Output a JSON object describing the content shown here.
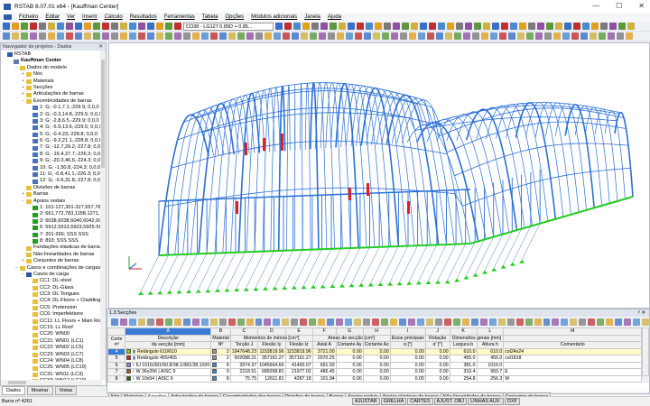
{
  "window": {
    "title": "RSTAB 8.07.01 x64 - [Kauffman Center]",
    "min": "—",
    "max": "☐",
    "close": "✕"
  },
  "menu": [
    "Ficheiro",
    "Editar",
    "Ver",
    "Inserir",
    "Cálculo",
    "Resultados",
    "Ferramentas",
    "Tabela",
    "Opções",
    "Módulos adicionais",
    "Janela",
    "Ajuda"
  ],
  "toolbar": {
    "load_combo": "CO38 - LG127 0.85D + 0.85..."
  },
  "navigator": {
    "title": "Navegador de projetos - Dados",
    "close": "✕",
    "pin": "ᵖ",
    "items": [
      {
        "d": 0,
        "t": "RSTAB",
        "i": "app"
      },
      {
        "d": 1,
        "t": "Kauffman Center",
        "i": "model",
        "b": true
      },
      {
        "d": 2,
        "t": "Dados do modelo",
        "i": "folder",
        "e": "−"
      },
      {
        "d": 3,
        "t": "Nós",
        "i": "folder",
        "e": "+"
      },
      {
        "d": 3,
        "t": "Materiais",
        "i": "folder",
        "e": "+"
      },
      {
        "d": 3,
        "t": "Secções",
        "i": "folder",
        "e": "+"
      },
      {
        "d": 3,
        "t": "Articulações de barras",
        "i": "folder",
        "e": "+"
      },
      {
        "d": 3,
        "t": "Excentricidades de barras",
        "i": "folder",
        "e": "−"
      },
      {
        "d": 4,
        "t": "1: G; -0.1,7.1,-229.9; 0,0,0",
        "i": "ecc"
      },
      {
        "d": 4,
        "t": "2: G; -0.3,14.8,-229.5; 0,0,0",
        "i": "ecc"
      },
      {
        "d": 4,
        "t": "3: G; -2.8,6.5,-229.9; 0,0,0",
        "i": "ecc"
      },
      {
        "d": 4,
        "t": "4: G; -5.9,13.6,-229.5; 0,0,0",
        "i": "ecc"
      },
      {
        "d": 4,
        "t": "5: G; -0.4,23,-228.8; 0,0,0",
        "i": "ecc"
      },
      {
        "d": 4,
        "t": "6: G; -9.2,21.1,-228.8; 0,0,0",
        "i": "ecc"
      },
      {
        "d": 4,
        "t": "7: G; -12.7,29.2,-227.8; 0,0,0",
        "i": "ecc"
      },
      {
        "d": 4,
        "t": "8: G; -16.4,37.7,-226.3; 0,0,0",
        "i": "ecc"
      },
      {
        "d": 4,
        "t": "9: G; -20.3,46.6,-224.3; 0,0,0",
        "i": "ecc"
      },
      {
        "d": 4,
        "t": "10: G; -1,50.8,-224.3; 0,0,0",
        "i": "ecc"
      },
      {
        "d": 4,
        "t": "11: G; -0.8,41.1,-226.3; 0,0,0",
        "i": "ecc"
      },
      {
        "d": 4,
        "t": "12: G; -0.6,31.8,-227.8; 0,0,0",
        "i": "ecc"
      },
      {
        "d": 3,
        "t": "Divisões de barras",
        "i": "folder"
      },
      {
        "d": 3,
        "t": "Barras",
        "i": "folder",
        "e": "+"
      },
      {
        "d": 3,
        "t": "Apoios nodais",
        "i": "folder",
        "e": "−"
      },
      {
        "d": 4,
        "t": "1: 101-127,301-327,657,768,779",
        "i": "sup"
      },
      {
        "d": 4,
        "t": "2: 661,772,783,1158,1271,1276,1",
        "i": "sup"
      },
      {
        "d": 4,
        "t": "3: 6038,6038,6040,6042,6044,60",
        "i": "sup"
      },
      {
        "d": 4,
        "t": "6: 5912,5913,5923,5925-5928,61",
        "i": "sup"
      },
      {
        "d": 4,
        "t": "7: 201-266; SSS SSS",
        "i": "sup"
      },
      {
        "d": 4,
        "t": "8: 893; SSS SSS",
        "i": "sup"
      },
      {
        "d": 3,
        "t": "Fundações elásticas de barras",
        "i": "folder"
      },
      {
        "d": 3,
        "t": "Não-linearidades de barras",
        "i": "folder"
      },
      {
        "d": 3,
        "t": "Conjuntos de barras",
        "i": "folder",
        "e": "+"
      },
      {
        "d": 2,
        "t": "Casos e combinações de cargass",
        "i": "folder",
        "e": "−"
      },
      {
        "d": 3,
        "t": "Casos de carga",
        "i": "lc",
        "e": "−"
      },
      {
        "d": 4,
        "t": "CC1: DL-steel",
        "i": "folder"
      },
      {
        "d": 4,
        "t": "CC2: DL-Glass",
        "i": "folder"
      },
      {
        "d": 4,
        "t": "CC3: DL Tongues",
        "i": "folder"
      },
      {
        "d": 4,
        "t": "CC4: DL-Floors + Cladding",
        "i": "folder"
      },
      {
        "d": 4,
        "t": "CC5: Pretension",
        "i": "folder"
      },
      {
        "d": 4,
        "t": "CC6: Imperfektions",
        "i": "folder"
      },
      {
        "d": 4,
        "t": "CC11: LL Floors + Main Roof",
        "i": "folder"
      },
      {
        "d": 4,
        "t": "CC15: LL Roof",
        "i": "folder"
      },
      {
        "d": 4,
        "t": "CC20: WN00",
        "i": "folder"
      },
      {
        "d": 4,
        "t": "CC21: WN01 (LC1)",
        "i": "folder"
      },
      {
        "d": 4,
        "t": "CC22: WN02 (LC5)",
        "i": "folder"
      },
      {
        "d": 4,
        "t": "CC23: WN03 (LC7)",
        "i": "folder"
      },
      {
        "d": 4,
        "t": "CC24: WN04 (LC8)",
        "i": "folder"
      },
      {
        "d": 4,
        "t": "CC25: WN05 (LC19)",
        "i": "folder"
      },
      {
        "d": 4,
        "t": "CC31: WN11 (LC3)",
        "i": "folder"
      },
      {
        "d": 4,
        "t": "CC32: WN12 (LC10)",
        "i": "folder"
      }
    ],
    "tabs": [
      "Dados",
      "Mostrar",
      "Vistas"
    ]
  },
  "panel": {
    "title": "1.3 Secções",
    "close": "ᵖ ✕",
    "letters": [
      "A",
      "B",
      "C",
      "D",
      "E",
      "F",
      "G",
      "H",
      "I",
      "J",
      "K",
      "L",
      "M"
    ],
    "groups": {
      "corte": "Corte nº",
      "desc": "Descrição",
      "material": "Material",
      "moments": "Momentos de inércia [cm⁴]",
      "areas": "Áreas de secção [cm²]",
      "axes": "Eixos principais",
      "rot": "Rotação",
      "dims": "Dimensões gerais [mm]"
    },
    "sub": [
      "da secção [mm]",
      "Nº",
      "Torção J",
      "Flexão Iy",
      "Flexão Iz",
      "Axial A",
      "Cortante Ay",
      "Cortante Az",
      "α [°]",
      "α' [°]",
      "Largura b",
      "Altura h",
      "Comentário"
    ],
    "rows": [
      {
        "no": "4",
        "color": "#8fbf2f",
        "shape": "▮",
        "desc": "Retângulo 610/610",
        "mc": "#9a9a9a",
        "mat": "2",
        "J": "1947648.23",
        "Iy": "1153819.96",
        "Iz": "1153819.96",
        "A": "3721.00",
        "Ay": "0.00",
        "Az": "0.00",
        "a": "0.00",
        "a2": "0.00",
        "b": "610.0",
        "h": "610.0",
        "c": "col24x24"
      },
      {
        "no": "5",
        "color": "#e01818",
        "shape": "▮",
        "desc": "Retângulo 455/455",
        "mc": "#9a9a9a",
        "mat": "2",
        "J": "602088.21",
        "Iy": "357161.27",
        "Iz": "357161.27",
        "A": "2070.25",
        "Ay": "0.00",
        "Az": "0.00",
        "a": "0.00",
        "a2": "0.00",
        "b": "455.0",
        "h": "455.0",
        "c": "col1818"
      },
      {
        "no": "6",
        "color": "#9a8ae0",
        "shape": "I",
        "desc": "IU 1016/381/50.8/38.1/381/38.1/0/0",
        "mc": "#3a8ee8",
        "mat": "8",
        "J": "3974.37",
        "Iy": "1045664.66",
        "Iz": "41400.07",
        "A": "691.93",
        "Ay": "0.00",
        "Az": "0.00",
        "a": "0.00",
        "a2": "0.00",
        "b": "381.0",
        "h": "1016.0",
        "c": ""
      },
      {
        "no": "7",
        "color": "#9a5a20",
        "shape": "I",
        "desc": "W 36x256 | AISC 9",
        "mc": "#3a8ee8",
        "mat": "9",
        "J": "2218.51",
        "Iy": "689268.81",
        "Iz": "21977.02",
        "A": "486.45",
        "Ay": "0.00",
        "Az": "0.00",
        "a": "0.00",
        "a2": "0.00",
        "b": "310.4",
        "h": "950.7",
        "c": "E"
      },
      {
        "no": "8",
        "color": "#2a5a10",
        "shape": "I",
        "desc": "W 10x54 | AISC 9",
        "mc": "#3a8ee8",
        "mat": "8",
        "J": "75.75",
        "Iy": "12611.81",
        "Iz": "4287.18",
        "A": "101.94",
        "Ay": "0.00",
        "Az": "0.00",
        "a": "0.00",
        "a2": "0.00",
        "b": "254.8",
        "h": "256.3",
        "c": "W"
      }
    ],
    "tabs": [
      "Nós",
      "Materiais",
      "Secções",
      "Articulações de barras",
      "Excentricidades das barras",
      "Divisões de barras",
      "Barras",
      "Apoios nodais",
      "Apoios elásticos de barras",
      "Não-linearidades de barras",
      "Conjuntos de barras"
    ],
    "active_tab": "Secções"
  },
  "status": {
    "left": "Barra nº 4261",
    "buttons": [
      "AJUSTAR",
      "GRELHA",
      "CARTES",
      "AJUST. OBJ",
      "LINHAS AUX.",
      "DXF"
    ]
  },
  "colors": {
    "member": "#2b6fd6",
    "support": "#22cc22",
    "highlight": "#e02020"
  }
}
